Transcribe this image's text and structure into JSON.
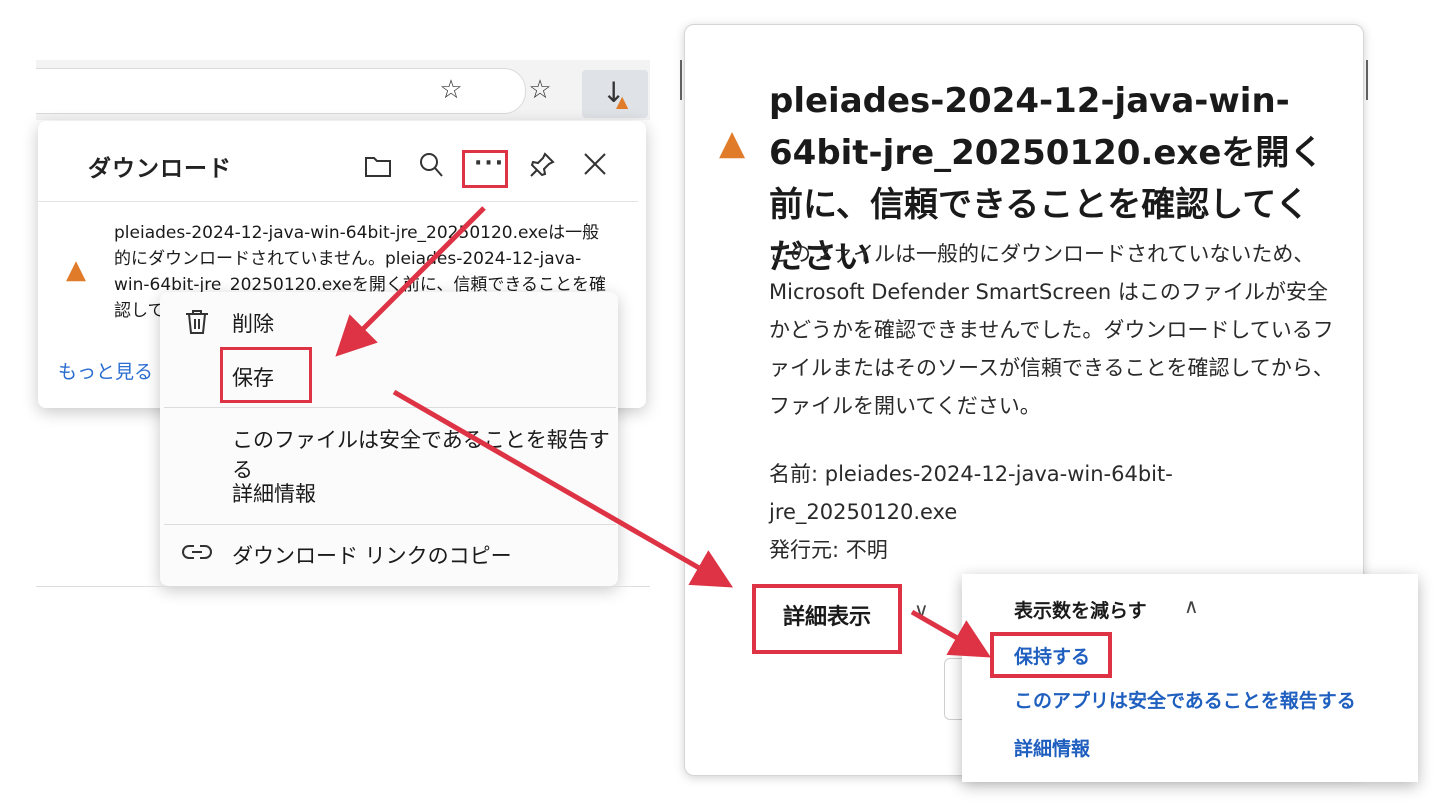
{
  "left": {
    "panel": {
      "title": "ダウンロード",
      "message": "pleiades-2024-12-java-win-64bit-jre_20250120.exeは一般的にダウンロードされていません。pleiades-2024-12-java-win-64bit-jre_20250120.exeを開く前に、信頼できることを確認して",
      "more_link": "もっと見る"
    },
    "menu": {
      "delete": "削除",
      "save": "保存",
      "report_safe": "このファイルは安全であることを報告する",
      "details": "詳細情報",
      "copy_link": "ダウンロード リンクのコピー"
    }
  },
  "right": {
    "dialog": {
      "title": "pleiades-2024-12-java-win-64bit-jre_20250120.exeを開く前に、信頼できることを確認してください",
      "description": "このファイルは一般的にダウンロードされていないため、Microsoft Defender SmartScreen はこのファイルが安全かどうかを確認できませんでした。ダウンロードしているファイルまたはそのソースが信頼できることを確認してから、ファイルを開いてください。",
      "name_line": "名前: pleiades-2024-12-java-win-64bit-jre_20250120.exe",
      "publisher_line": "発行元: 不明",
      "show_more": "詳細表示"
    },
    "popup": {
      "show_less": "表示数を減らす",
      "keep": "保持する",
      "report_safe": "このアプリは安全であることを報告する",
      "details": "詳細情報"
    }
  },
  "icons": {
    "star": "star-icon",
    "favorites": "favorites-icon",
    "download": "download-icon",
    "warning": "warning-icon",
    "folder": "folder-icon",
    "search": "search-icon",
    "more": "more-icon",
    "pin": "pin-icon",
    "close": "close-icon",
    "trash": "trash-icon",
    "link": "link-icon",
    "chevron_down": "chevron-down-icon",
    "chevron_up": "chevron-up-icon"
  },
  "colors": {
    "highlight": "#dd3344",
    "warning": "#e07b2a",
    "link": "#1f5fbf"
  }
}
